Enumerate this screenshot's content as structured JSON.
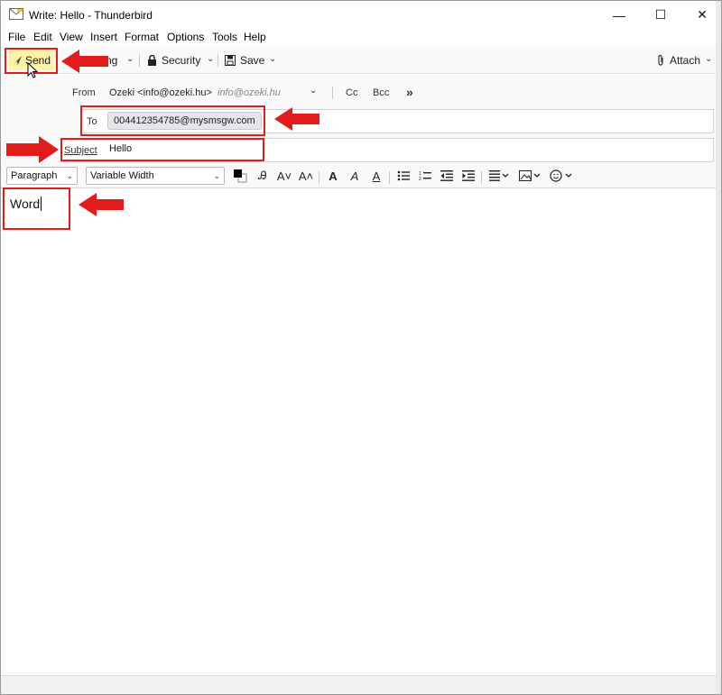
{
  "window": {
    "title": "Write: Hello - Thunderbird",
    "controls": {
      "minimize": "—",
      "maximize": "☐",
      "close": "✕"
    }
  },
  "menu": [
    "File",
    "Edit",
    "View",
    "Insert",
    "Format",
    "Options",
    "Tools",
    "Help"
  ],
  "toolbar": {
    "send_label": "Send",
    "spelling_partial": "ng",
    "security_label": "Security",
    "save_label": "Save",
    "attach_label": "Attach"
  },
  "header": {
    "from_label": "From",
    "from_value": "Ozeki <info@ozeki.hu>",
    "from_alt": "info@ozeki.hu",
    "cc_label": "Cc",
    "bcc_label": "Bcc",
    "to_label": "To",
    "to_recipient": "004412354785@mysmsgw.com",
    "subject_label": "Subject",
    "subject_value": "Hello"
  },
  "format": {
    "paragraph_select": "Paragraph",
    "font_select": "Variable Width"
  },
  "message": {
    "body_text": "Word"
  },
  "colors": {
    "highlight_red": "#e21b1b",
    "window_bg": "#f9f9fa"
  },
  "icons": [
    "send-icon",
    "lock-icon",
    "save-icon",
    "paperclip-icon",
    "chevron-right-double-icon",
    "text-color-icon",
    "smaller-text-icon",
    "larger-text-icon",
    "bold-icon",
    "italic-icon",
    "underline-icon",
    "bullet-list-icon",
    "numbered-list-icon",
    "outdent-icon",
    "indent-icon",
    "align-icon",
    "insert-image-icon",
    "emoji-icon"
  ]
}
